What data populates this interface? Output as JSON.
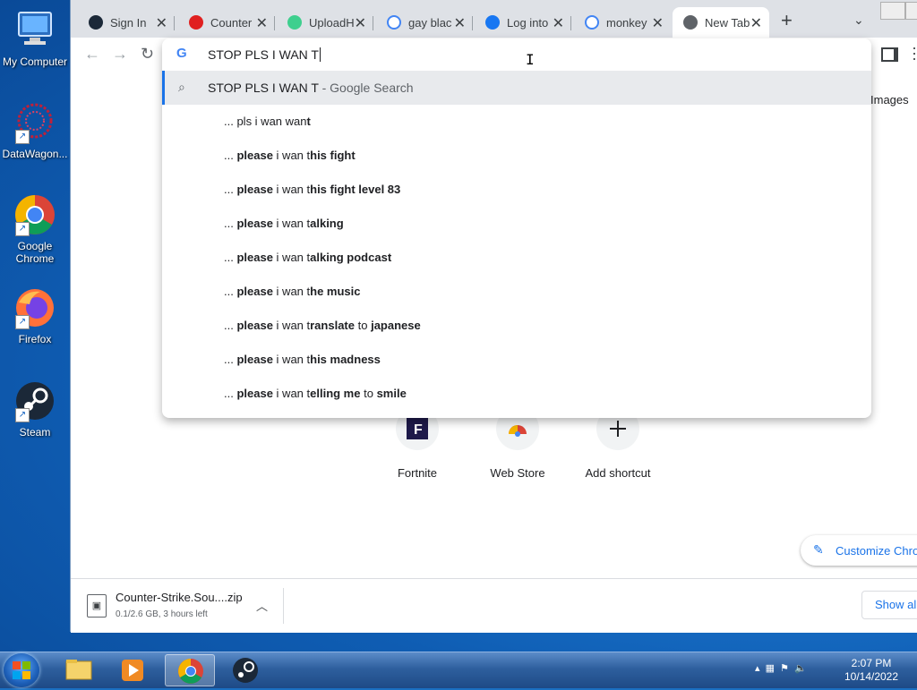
{
  "desktop": {
    "icons": [
      {
        "label": "My Computer"
      },
      {
        "label": "DataWagon..."
      },
      {
        "label": "Google Chrome"
      },
      {
        "label": "Firefox"
      },
      {
        "label": "Steam"
      }
    ]
  },
  "browser": {
    "tabs": [
      {
        "title": "Sign In",
        "icon": "steam-icon"
      },
      {
        "title": "Counter",
        "icon": "counter-icon"
      },
      {
        "title": "UploadH",
        "icon": "upload-icon"
      },
      {
        "title": "gay blac",
        "icon": "google-icon"
      },
      {
        "title": "Log into",
        "icon": "facebook-icon"
      },
      {
        "title": "monkey",
        "icon": "google-icon"
      },
      {
        "title": "New Tab",
        "icon": "chrome-icon",
        "active": true
      }
    ],
    "omnibox": {
      "query": "STOP PLS I WAN T",
      "top_suggestion": {
        "text": "STOP PLS I WAN T",
        "suffix": " - Google Search"
      },
      "suggestions": [
        {
          "prefix": "... pls i wan wan",
          "bold": "t",
          "rest": ""
        },
        {
          "prefix": "... ",
          "bold_word": "please",
          "mid": " i wan t",
          "bold": "his fight"
        },
        {
          "prefix": "... ",
          "bold_word": "please",
          "mid": " i wan t",
          "bold": "his fight level 83"
        },
        {
          "prefix": "... ",
          "bold_word": "please",
          "mid": " i wan t",
          "bold": "alking"
        },
        {
          "prefix": "... ",
          "bold_word": "please",
          "mid": " i wan t",
          "bold": "alking podcast"
        },
        {
          "prefix": "... ",
          "bold_word": "please",
          "mid": " i wan t",
          "bold": "he music"
        },
        {
          "prefix": "... ",
          "bold_word": "please",
          "mid": " i wan t",
          "bold": "ranslate",
          "mid2": " to ",
          "bold2": "japanese"
        },
        {
          "prefix": "... ",
          "bold_word": "please",
          "mid": " i wan t",
          "bold": "his madness"
        },
        {
          "prefix": "... ",
          "bold_word": "please",
          "mid": " i wan t",
          "bold": "elling me",
          "mid2": " to ",
          "bold2": "smile"
        }
      ]
    },
    "new_tab": {
      "images_link": "Images",
      "shortcuts": [
        {
          "name": "Fortnite"
        },
        {
          "name": "Web Store"
        },
        {
          "name": "Add shortcut"
        }
      ],
      "customize_label": "Customize Chro"
    },
    "downloads": {
      "file_name": "Counter-Strike.Sou....zip",
      "status": "0.1/2.6 GB, 3 hours left",
      "show_all": "Show all"
    }
  },
  "taskbar": {
    "time": "2:07 PM",
    "date": "10/14/2022"
  },
  "colors": {
    "accent": "#1a73e8",
    "tabstrip": "#dee1e6",
    "desktop": "#1c78d0"
  }
}
